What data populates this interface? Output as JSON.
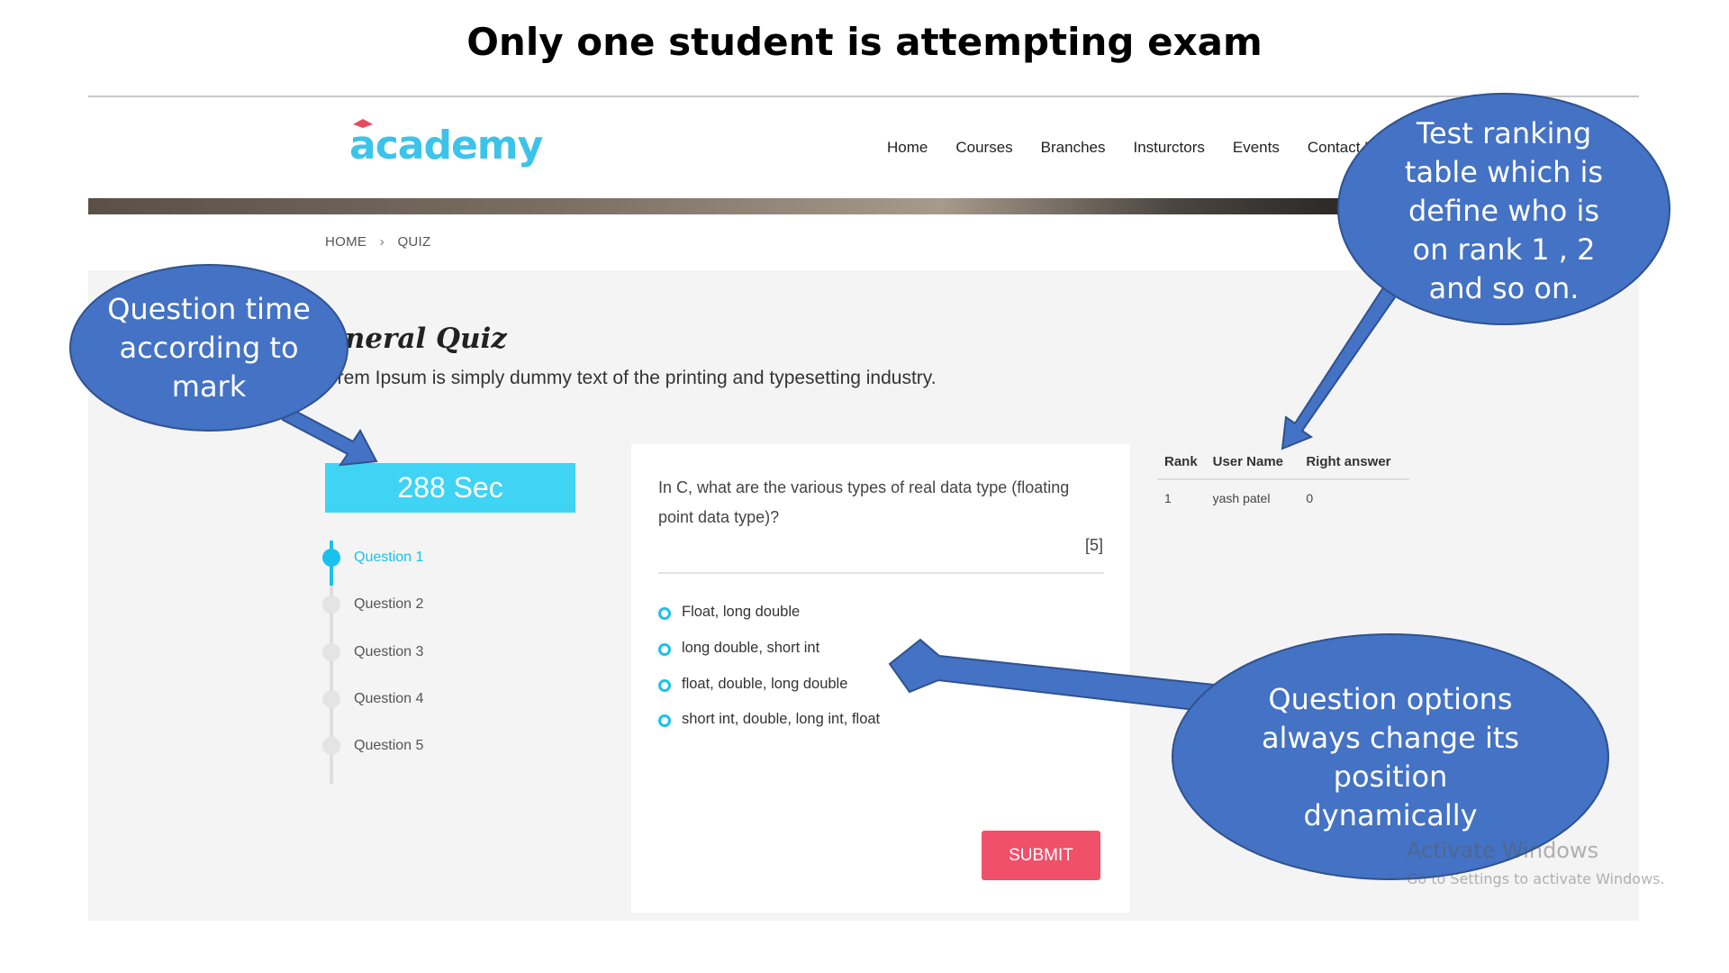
{
  "slide": {
    "title": "Only one student is attempting exam"
  },
  "site": {
    "logo": "academy",
    "nav": [
      "Home",
      "Courses",
      "Branches",
      "Insturctors",
      "Events",
      "Contact U"
    ]
  },
  "breadcrumb": {
    "home": "HOME",
    "separator": "›",
    "current": "QUIZ"
  },
  "quiz": {
    "title": "eneral Quiz",
    "subtitle": "orem Ipsum is simply dummy text of the printing and typesetting industry.",
    "timer": "288 Sec",
    "questions": [
      "Question 1",
      "Question 2",
      "Question 3",
      "Question 4",
      "Question 5"
    ],
    "active_question_index": 0,
    "question_text": "In C, what are the various types of real data type (floating point data type)?",
    "marks": "[5]",
    "options": [
      "Float, long double",
      "long double, short int",
      "float, double, long double",
      "short int, double, long int, float"
    ],
    "submit_label": "SUBMIT"
  },
  "ranking": {
    "headers": [
      "Rank",
      "User Name",
      "Right answer"
    ],
    "rows": [
      [
        "1",
        "yash patel",
        "0"
      ]
    ]
  },
  "annotations": {
    "timer_note": "Question time according to mark",
    "ranking_note": "Test ranking table which is define who is on rank 1 , 2 and so on.",
    "options_note": "Question options always change its position dynamically"
  },
  "watermark": {
    "line1": "Activate Windows",
    "line2": "Go to Settings to activate Windows."
  },
  "colors": {
    "accent": "#3fd3f4",
    "submit": "#f0506a",
    "bubble": "#4472c4",
    "bubble_border": "#2f528f"
  }
}
